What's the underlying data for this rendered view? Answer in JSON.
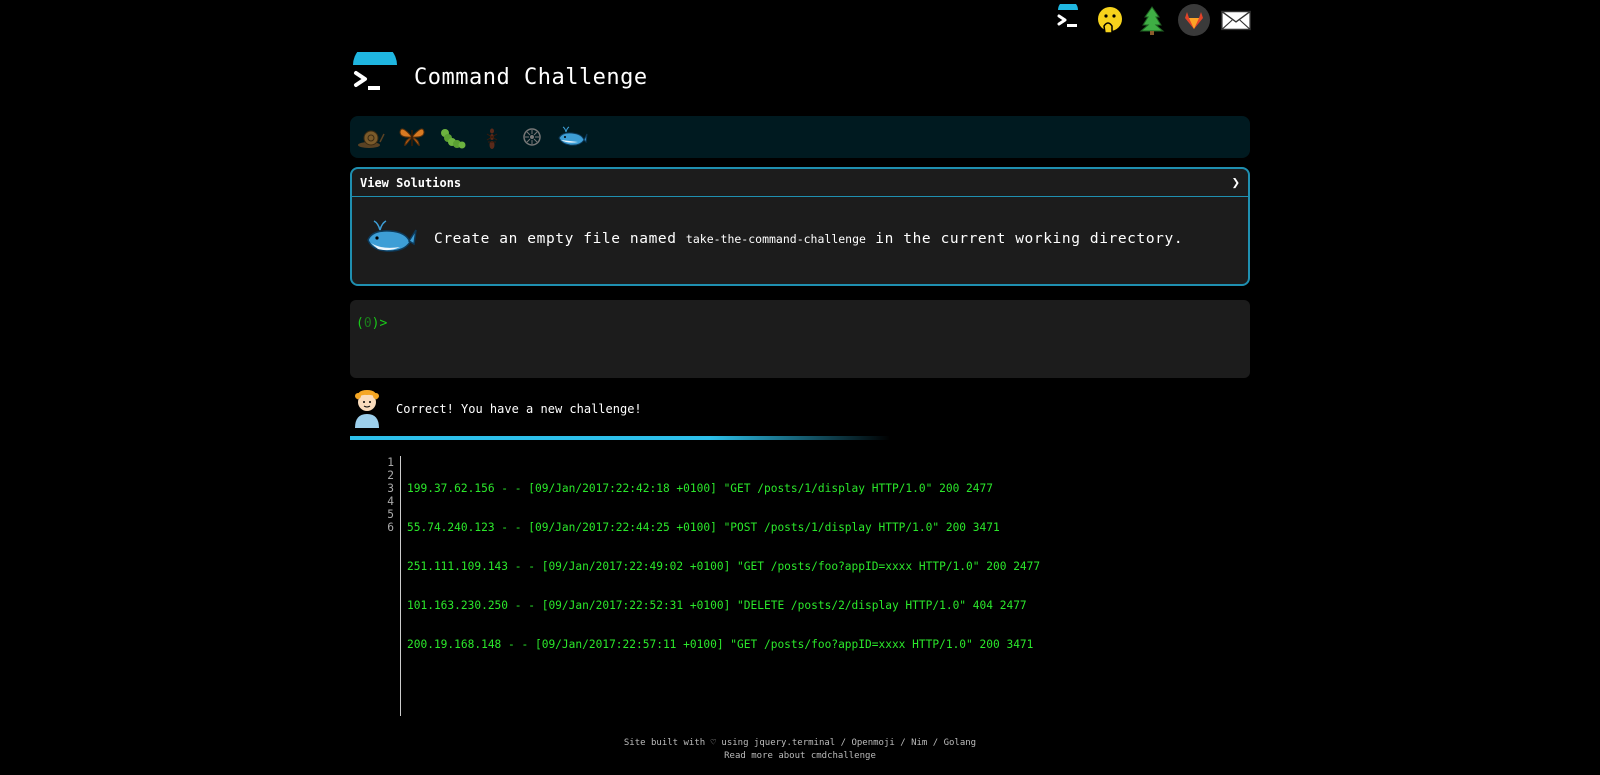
{
  "site": {
    "title": "Command Challenge"
  },
  "top_icons": [
    {
      "icon": "terminal-icon"
    },
    {
      "icon": "face-hand-over-mouth-icon"
    },
    {
      "icon": "tree-icon"
    },
    {
      "icon": "gitlab-icon"
    },
    {
      "icon": "envelope-icon"
    }
  ],
  "levels": [
    "snail-icon",
    "butterfly-icon",
    "caterpillar-icon",
    "ant-icon",
    "sand-dollar-icon",
    "whale-icon"
  ],
  "challenge": {
    "solutions_label": "View Solutions",
    "text_before": "Create an empty file named",
    "filename": "take-the-command-challenge",
    "text_after": "in the current working directory."
  },
  "terminal": {
    "prompt_open": "(",
    "prompt_zero": "0",
    "prompt_close": ")>"
  },
  "feedback": {
    "message": "Correct! You have a new challenge!"
  },
  "code": {
    "line_numbers": [
      "1",
      "2",
      "3",
      "4",
      "5",
      "6"
    ],
    "lines": [
      "199.37.62.156 - - [09/Jan/2017:22:42:18 +0100] \"GET /posts/1/display HTTP/1.0\" 200 2477",
      "55.74.240.123 - - [09/Jan/2017:22:44:25 +0100] \"POST /posts/1/display HTTP/1.0\" 200 3471",
      "251.111.109.143 - - [09/Jan/2017:22:49:02 +0100] \"GET /posts/foo?appID=xxxx HTTP/1.0\" 200 2477",
      "101.163.230.250 - - [09/Jan/2017:22:52:31 +0100] \"DELETE /posts/2/display HTTP/1.0\" 404 2477",
      "200.19.168.148 - - [09/Jan/2017:22:57:11 +0100] \"GET /posts/foo?appID=xxxx HTTP/1.0\" 200 3471",
      ""
    ]
  },
  "footer": {
    "line1": "Site built with ♡ using jquery.terminal / Openmoji / Nim / Golang",
    "line2": "Read more about cmdchallenge"
  },
  "colors": {
    "accent": "#1f8fb0",
    "prompt_green": "#19c919",
    "log_green": "#2be82b",
    "progress": "#2dc0ea"
  }
}
